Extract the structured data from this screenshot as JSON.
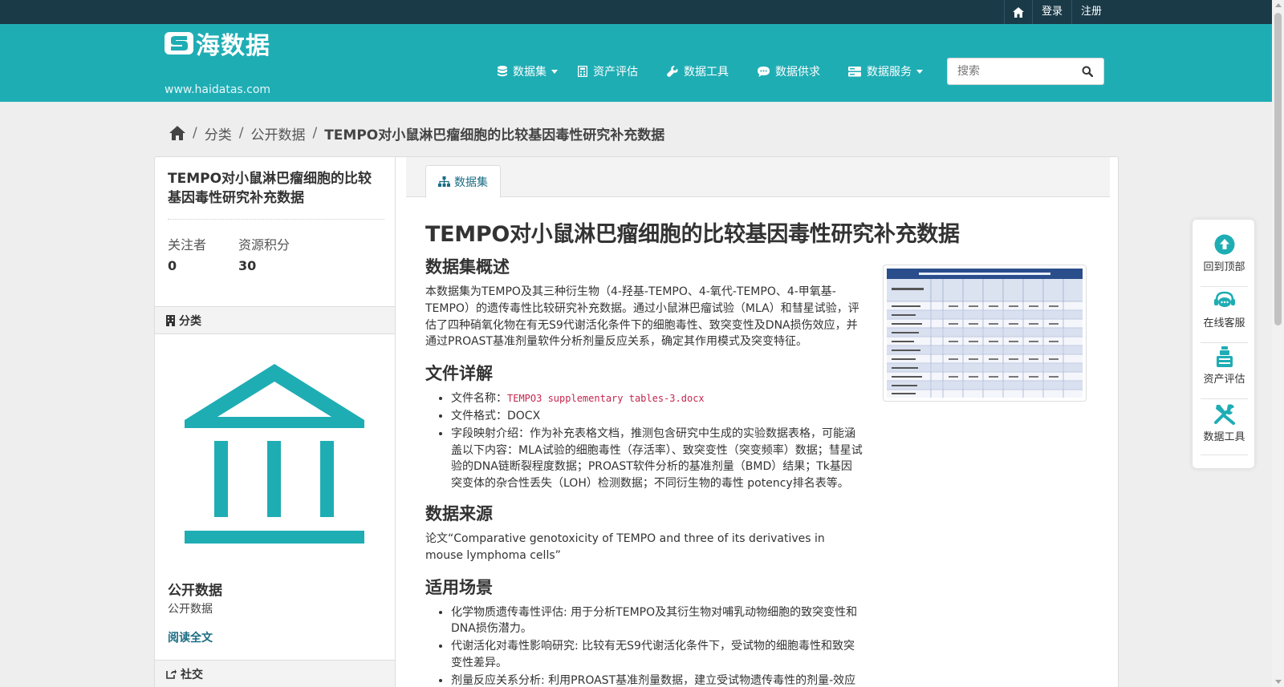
{
  "account_bar": {
    "home_icon": "home-icon",
    "login_label": "登录",
    "register_label": "注册"
  },
  "header": {
    "logo_text": "海数据",
    "site_url": "www.haidatas.com",
    "nav": [
      {
        "label": "数据集",
        "icon": "database-icon",
        "dropdown": true
      },
      {
        "label": "资产评估",
        "icon": "calculator-icon",
        "dropdown": false
      },
      {
        "label": "数据工具",
        "icon": "wrench-icon",
        "dropdown": false
      },
      {
        "label": "数据供求",
        "icon": "comment-icon",
        "dropdown": false
      },
      {
        "label": "数据服务",
        "icon": "server-icon",
        "dropdown": true
      }
    ],
    "search": {
      "placeholder": "搜索",
      "value": ""
    }
  },
  "breadcrumb": {
    "home_icon": "home-icon",
    "items": [
      "分类",
      "公开数据"
    ],
    "current": "TEMPO对小鼠淋巴瘤细胞的比较基因毒性研究补充数据"
  },
  "sidebar": {
    "title": "TEMPO对小鼠淋巴瘤细胞的比较基因毒性研究补充数据",
    "stats": [
      {
        "label": "关注者",
        "value": "0"
      },
      {
        "label": "资源积分",
        "value": "30"
      }
    ],
    "category_heading": "分类",
    "org_icon": "institution-icon",
    "org_title": "公开数据",
    "org_description": "公开数据",
    "read_more": "阅读全文",
    "social_heading": "社交"
  },
  "main": {
    "tab_label": "数据集",
    "tab_icon": "sitemap-icon",
    "heading": "TEMPO对小鼠淋巴瘤细胞的比较基因毒性研究补充数据",
    "overview_heading": "数据集概述",
    "overview_text": "本数据集为TEMPO及其三种衍生物（4-羟基-TEMPO、4-氧代-TEMPO、4-甲氧基-TEMPO）的遗传毒性比较研究补充数据。通过小鼠淋巴瘤试验（MLA）和彗星试验，评估了四种硝氧化物在有无S9代谢活化条件下的细胞毒性、致突变性及DNA损伤效应，并通过PROAST基准剂量软件分析剂量反应关系，确定其作用模式及突变特征。",
    "file_heading": "文件详解",
    "file_name_label": "文件名称：",
    "file_name": "TEMPO3 supplementary tables-3.docx",
    "file_format": "文件格式：DOCX",
    "field_mapping": "字段映射介绍：作为补充表格文档，推测包含研究中生成的实验数据表格，可能涵盖以下内容：MLA试验的细胞毒性（存活率）、致突变性（突变频率）数据；彗星试验的DNA链断裂程度数据；PROAST软件分析的基准剂量（BMD）结果；Tk基因突变体的杂合性丢失（LOH）检测数据；不同衍生物的毒性 potency排名表等。",
    "source_heading": "数据来源",
    "source_text": "论文“Comparative genotoxicity of TEMPO and three of its derivatives in mouse lymphoma cells”",
    "scenarios_heading": "适用场景",
    "scenarios": [
      "化学物质遗传毒性评估: 用于分析TEMPO及其衍生物对哺乳动物细胞的致突变性和DNA损伤潜力。",
      "代谢活化对毒性影响研究: 比较有无S9代谢活化条件下，受试物的细胞毒性和致突变性差异。",
      "剂量反应关系分析: 利用PROAST基准剂量数据，建立受试物遗传毒性的剂量-效应模型。"
    ]
  },
  "float_bar": [
    {
      "label": "回到顶部",
      "icon": "arrow-up-circle-icon"
    },
    {
      "label": "在线客服",
      "icon": "chat-support-icon"
    },
    {
      "label": "资产评估",
      "icon": "flask-icon"
    },
    {
      "label": "数据工具",
      "icon": "tools-icon"
    }
  ],
  "colors": {
    "brand_teal": "#1fadb4",
    "top_bar": "#1a3a48",
    "link": "#1a6d84",
    "code": "#c7254e"
  }
}
